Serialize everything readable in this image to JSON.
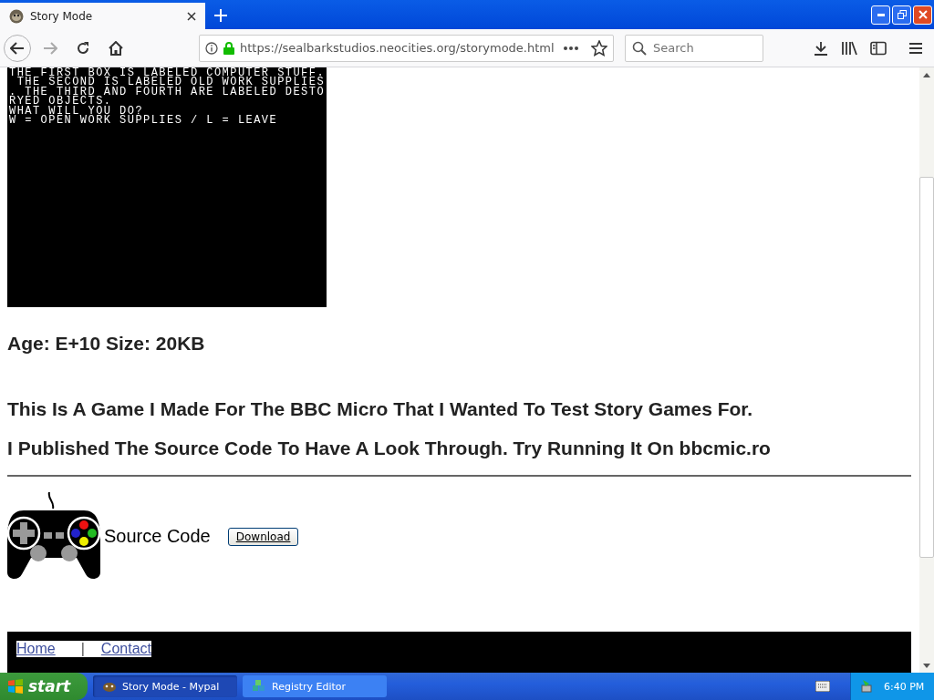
{
  "browser": {
    "tab": {
      "title": "Story Mode",
      "selected": true
    },
    "url": "https://sealbarkstudios.neocities.org/storymode.html",
    "search": {
      "placeholder": "Search"
    }
  },
  "page": {
    "screen_lines": [
      "THE FIRST BOX IS LABELED COMPUTER STUFF.",
      " THE SECOND IS LABELED OLD WORK SUPPLIES",
      ". THE THIRD AND FOURTH ARE LABELED DESTO",
      "RYED OBJECTS.",
      "WHAT WILL YOU DO?",
      "W = OPEN WORK SUPPLIES / L = LEAVE"
    ],
    "info": "Age: E+10 Size: 20KB",
    "paragraphs": [
      "This Is A Game I Made For The BBC Micro That I Wanted To Test Story Games For.",
      "I Published The Source Code To Have A Look Through. Try Running It On bbcmic.ro"
    ],
    "download": {
      "label": "Source Code",
      "button": "Download"
    },
    "footer_links": [
      "Home",
      "Contact"
    ],
    "footer_separator": "|"
  },
  "taskbar": {
    "start": "start",
    "tasks": [
      {
        "label": "Story Mode - Mypal",
        "selected": true
      },
      {
        "label": "Registry Editor",
        "selected": false
      }
    ],
    "clock": "6:40 PM"
  }
}
